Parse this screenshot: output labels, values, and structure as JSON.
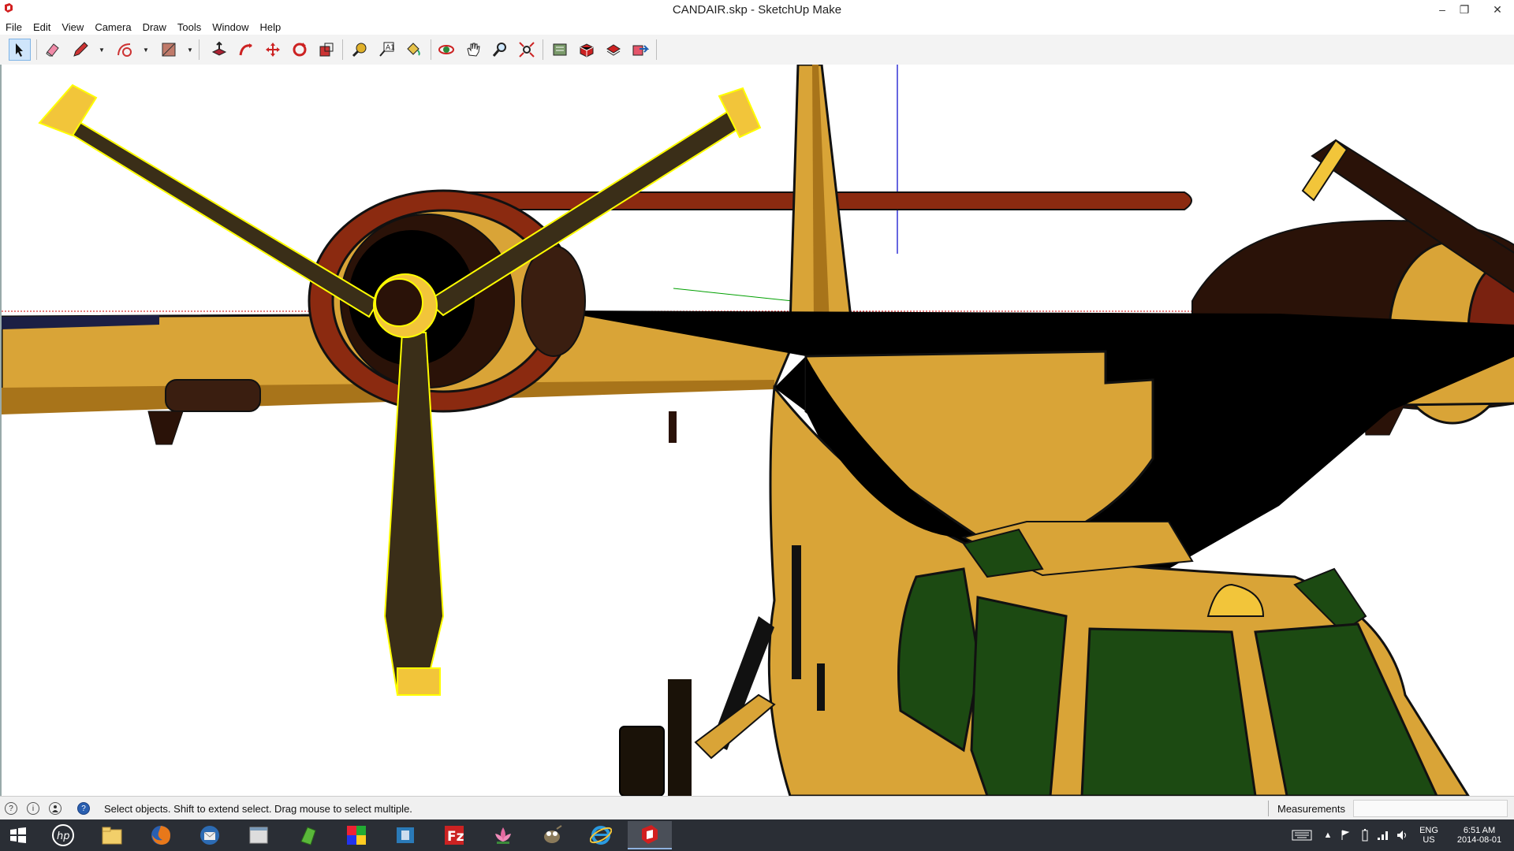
{
  "window": {
    "title": "CANDAIR.skp - SketchUp Make",
    "minimize": "–",
    "maximize": "❐",
    "close": "✕"
  },
  "menubar": {
    "items": [
      "File",
      "Edit",
      "View",
      "Camera",
      "Draw",
      "Tools",
      "Window",
      "Help"
    ]
  },
  "toolbar": {
    "tools": [
      "select",
      "eraser",
      "line",
      "arc",
      "rectangle",
      "push-pull",
      "follow-me",
      "move",
      "rotate",
      "scale",
      "tape-measure",
      "text",
      "paint-bucket",
      "orbit",
      "pan",
      "zoom",
      "zoom-extents",
      "3d-warehouse",
      "extension-warehouse",
      "layout",
      "share-model"
    ],
    "active_tool": "select"
  },
  "statusbar": {
    "hint": "Select objects. Shift to extend select. Drag mouse to select multiple.",
    "icon_geo": "?",
    "icon_info": "i",
    "icon_help": "?",
    "measurements_label": "Measurements",
    "measurements_value": ""
  },
  "taskbar": {
    "apps": [
      "start",
      "hp",
      "file-explorer",
      "firefox",
      "thunderbird",
      "window-app",
      "green-app",
      "photo-app",
      "movie-app",
      "filezilla",
      "lotus-app",
      "gimp",
      "internet-explorer",
      "sketchup"
    ],
    "active_app": "sketchup",
    "tray": {
      "lang": "ENG",
      "region": "US",
      "time": "6:51 AM",
      "date": "2014-08-01"
    }
  },
  "scene": {
    "colors": {
      "body": "#d9a437",
      "body_dark": "#a8741a",
      "shadow": "#000000",
      "prop": "#3a2e18",
      "prop_tip": "#f2c53a",
      "selection": "#ffff00",
      "nacelle": "#7a2210",
      "glass": "#1c4a12",
      "axis_red": "#cc0000",
      "axis_green": "#00a000",
      "axis_blue": "#0000cc"
    }
  }
}
